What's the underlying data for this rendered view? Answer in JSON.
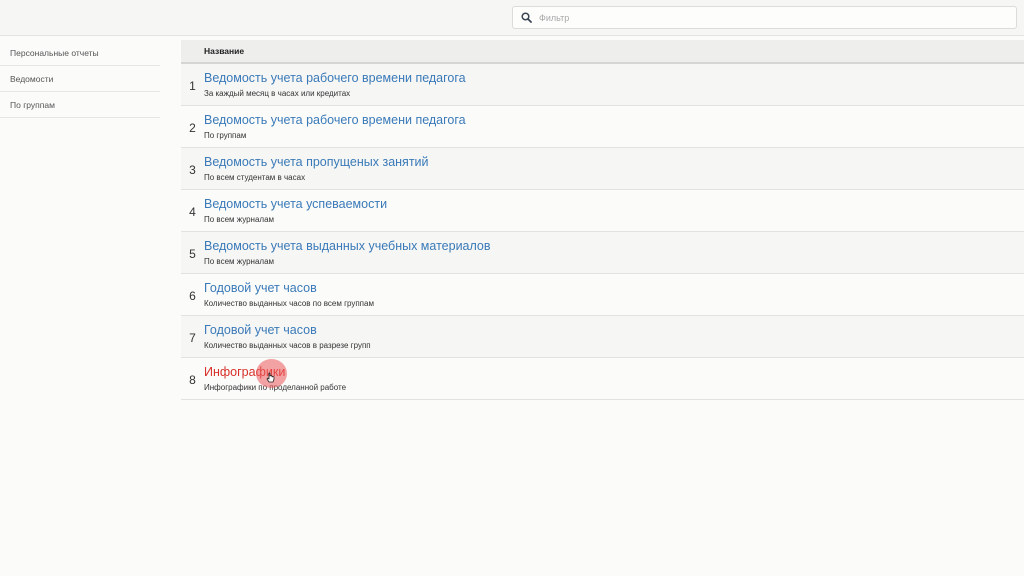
{
  "search": {
    "placeholder": "Фильтр",
    "value": ""
  },
  "sidebar": {
    "items": [
      {
        "label": "Персональные отчеты"
      },
      {
        "label": "Ведомости"
      },
      {
        "label": "По группам"
      }
    ]
  },
  "table": {
    "header": {
      "name": "Название"
    },
    "rows": [
      {
        "num": "1",
        "title": "Ведомость учета рабочего времени педагога",
        "desc": "За каждый месяц в часах или кредитах"
      },
      {
        "num": "2",
        "title": "Ведомость учета рабочего времени педагога",
        "desc": "По группам"
      },
      {
        "num": "3",
        "title": "Ведомость учета пропущеных занятий",
        "desc": "По всем студентам в часах"
      },
      {
        "num": "4",
        "title": "Ведомость учета успеваемости",
        "desc": "По всем журналам"
      },
      {
        "num": "5",
        "title": "Ведомость учета выданных учебных материалов",
        "desc": "По всем журналам"
      },
      {
        "num": "6",
        "title": "Годовой учет часов",
        "desc": "Количество выданных часов по всем группам"
      },
      {
        "num": "7",
        "title": "Годовой учет часов",
        "desc": "Количество выданных часов в разрезе групп"
      },
      {
        "num": "8",
        "title": "Инфографики",
        "desc": "Инфографики по проделанной работе"
      }
    ]
  },
  "colors": {
    "link": "#3a7ab8",
    "link_active": "#d8302a"
  },
  "icons": {
    "search": "search-icon",
    "cursor": "mouse-pointer-icon"
  }
}
